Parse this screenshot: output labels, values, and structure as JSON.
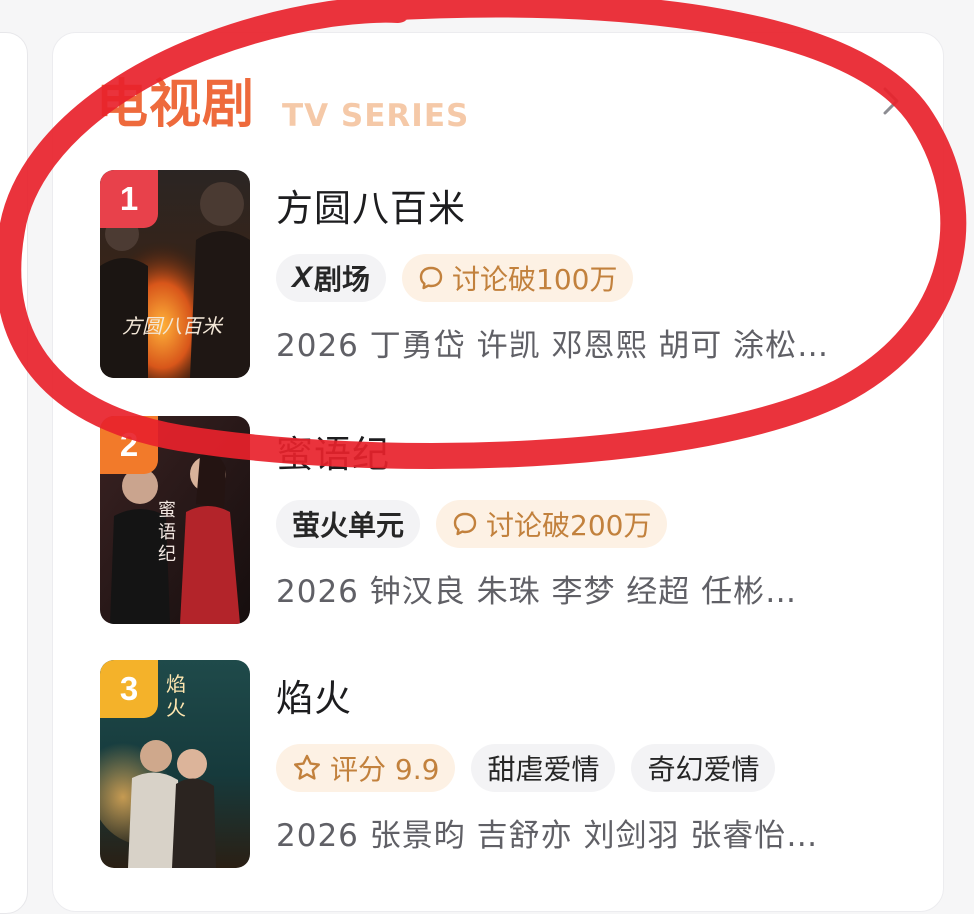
{
  "section": {
    "title_cn": "电视剧",
    "title_en": "TV SERIES",
    "more_icon": "chevron-right-icon"
  },
  "items": [
    {
      "rank": "1",
      "rank_color": "#e8414b",
      "title": "方圆八百米",
      "platform": "剧场",
      "platform_mark": "X",
      "hot_icon": "comment-icon",
      "hot_label": "讨论破100万",
      "meta": "2026 丁勇岱 许凯 邓恩熙 胡可 涂松…",
      "poster_text": "方圆八百米"
    },
    {
      "rank": "2",
      "rank_color": "#f27a2a",
      "title": "蜜语纪",
      "platform": "萤火单元",
      "hot_icon": "comment-icon",
      "hot_label": "讨论破200万",
      "meta": "2026 钟汉良 朱珠 李梦 经超 任彬…",
      "poster_text": "蜜语纪"
    },
    {
      "rank": "3",
      "rank_color": "#f4b22a",
      "title": "焰火",
      "rating_icon": "star-icon",
      "rating_label": "评分 9.9",
      "genre_tags": [
        "甜虐爱情",
        "奇幻爱情"
      ],
      "meta": "2026 张景昀 吉舒亦 刘剑羽 张睿怡…",
      "poster_text": "焰火"
    }
  ],
  "colors": {
    "accent": "#ee6a3c",
    "title_en": "#f5c9a8",
    "hot_tag_bg": "#fdf1e4",
    "hot_tag_text": "#c2813d",
    "annotation_circle": "#e8222b"
  }
}
